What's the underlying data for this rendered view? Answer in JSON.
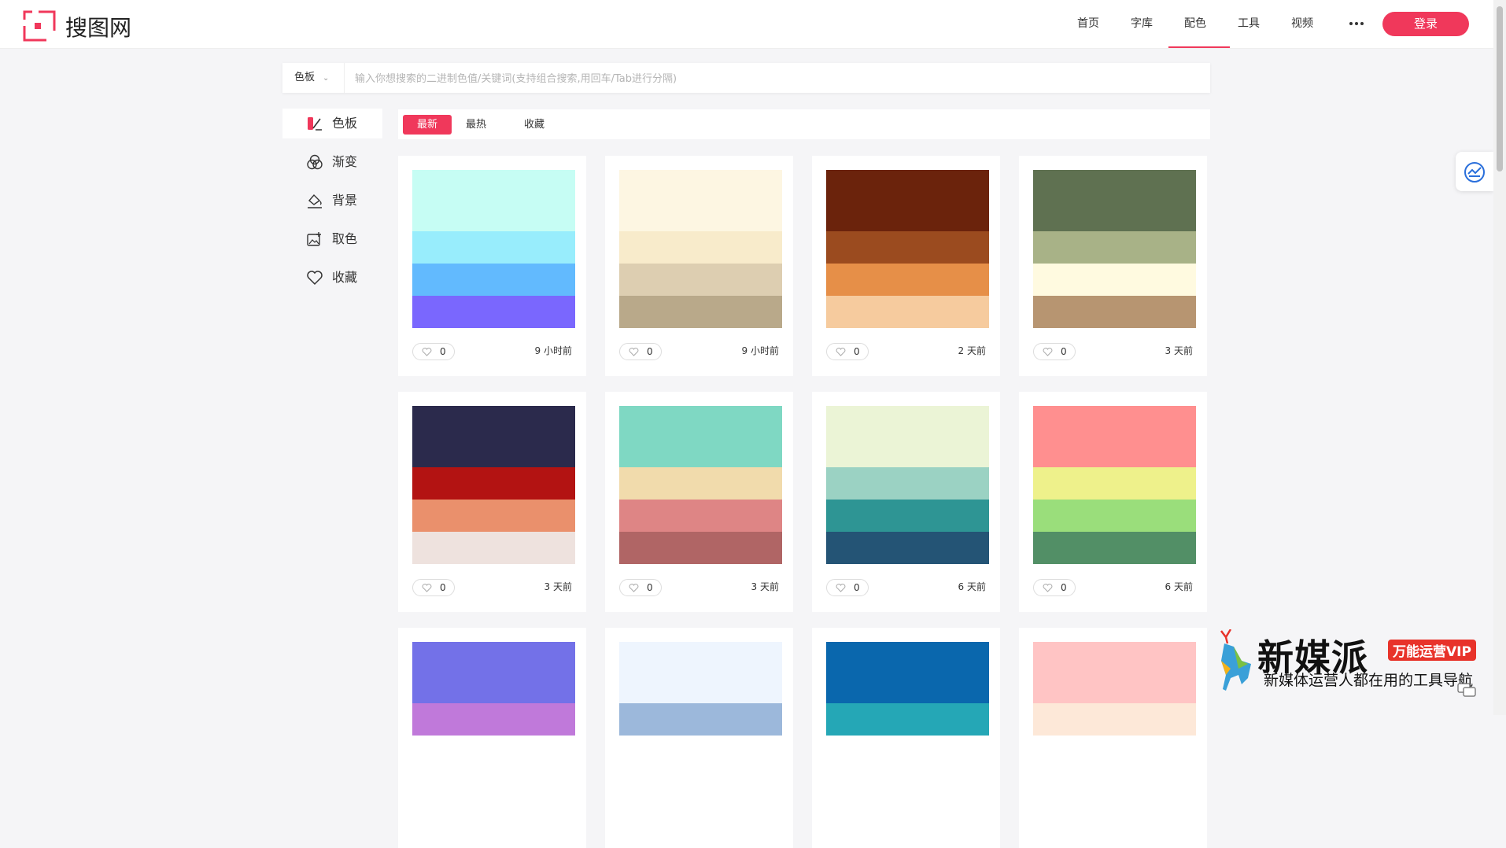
{
  "brand": {
    "name": "搜图网",
    "accent": "#f0385b"
  },
  "nav": {
    "items": [
      "首页",
      "字库",
      "配色",
      "工具",
      "视频"
    ],
    "active": "配色",
    "login_label": "登录"
  },
  "search": {
    "type_label": "色板",
    "placeholder": "输入你想搜索的二进制色值/关键词(支持组合搜索,用回车/Tab进行分隔)"
  },
  "sidebar": {
    "items": [
      {
        "label": "色板",
        "icon": "palette-icon",
        "active": true
      },
      {
        "label": "渐变",
        "icon": "gradient-icon",
        "active": false
      },
      {
        "label": "背景",
        "icon": "paint-bucket-icon",
        "active": false
      },
      {
        "label": "取色",
        "icon": "color-picker-icon",
        "active": false
      },
      {
        "label": "收藏",
        "icon": "heart-icon",
        "active": false
      }
    ]
  },
  "tabs": {
    "items": [
      "最新",
      "最热",
      "收藏"
    ],
    "active": "最新"
  },
  "palettes": [
    {
      "colors": [
        "#c6fdf4",
        "#98edfc",
        "#62bafe",
        "#7a67fe"
      ],
      "likes": "0",
      "time": "9 小时前"
    },
    {
      "colors": [
        "#fdf6e2",
        "#f8ebcb",
        "#ddceb1",
        "#b9a98a"
      ],
      "likes": "0",
      "time": "9 小时前"
    },
    {
      "colors": [
        "#6b230c",
        "#9b4b1f",
        "#e68f48",
        "#f6cb9e"
      ],
      "likes": "0",
      "time": "2 天前"
    },
    {
      "colors": [
        "#5f7151",
        "#a8b287",
        "#fffae0",
        "#b79571"
      ],
      "likes": "0",
      "time": "3 天前"
    },
    {
      "colors": [
        "#2b2a4c",
        "#b31312",
        "#ea906c",
        "#eee2de"
      ],
      "likes": "0",
      "time": "3 天前"
    },
    {
      "colors": [
        "#7fd8c3",
        "#f1dbac",
        "#de8585",
        "#b06565"
      ],
      "likes": "0",
      "time": "3 天前"
    },
    {
      "colors": [
        "#ebf4d6",
        "#9bd2c3",
        "#2e9594",
        "#245475"
      ],
      "likes": "0",
      "time": "6 天前"
    },
    {
      "colors": [
        "#ff8f8f",
        "#eef18b",
        "#9ade7b",
        "#528f66"
      ],
      "likes": "0",
      "time": "6 天前"
    },
    {
      "colors": [
        "#7371e8",
        "#c079da"
      ],
      "likes": "",
      "time": ""
    },
    {
      "colors": [
        "#eef5fe",
        "#9cb8db"
      ],
      "likes": "",
      "time": ""
    },
    {
      "colors": [
        "#0a67ad",
        "#25a7b6"
      ],
      "likes": "",
      "time": ""
    },
    {
      "colors": [
        "#ffc4c4",
        "#fde8d8"
      ],
      "likes": "",
      "time": ""
    }
  ],
  "promo": {
    "title": "新媒派",
    "badge": "万能运营VIP",
    "subtitle": "新媒体运营人都在用的工具导航"
  }
}
